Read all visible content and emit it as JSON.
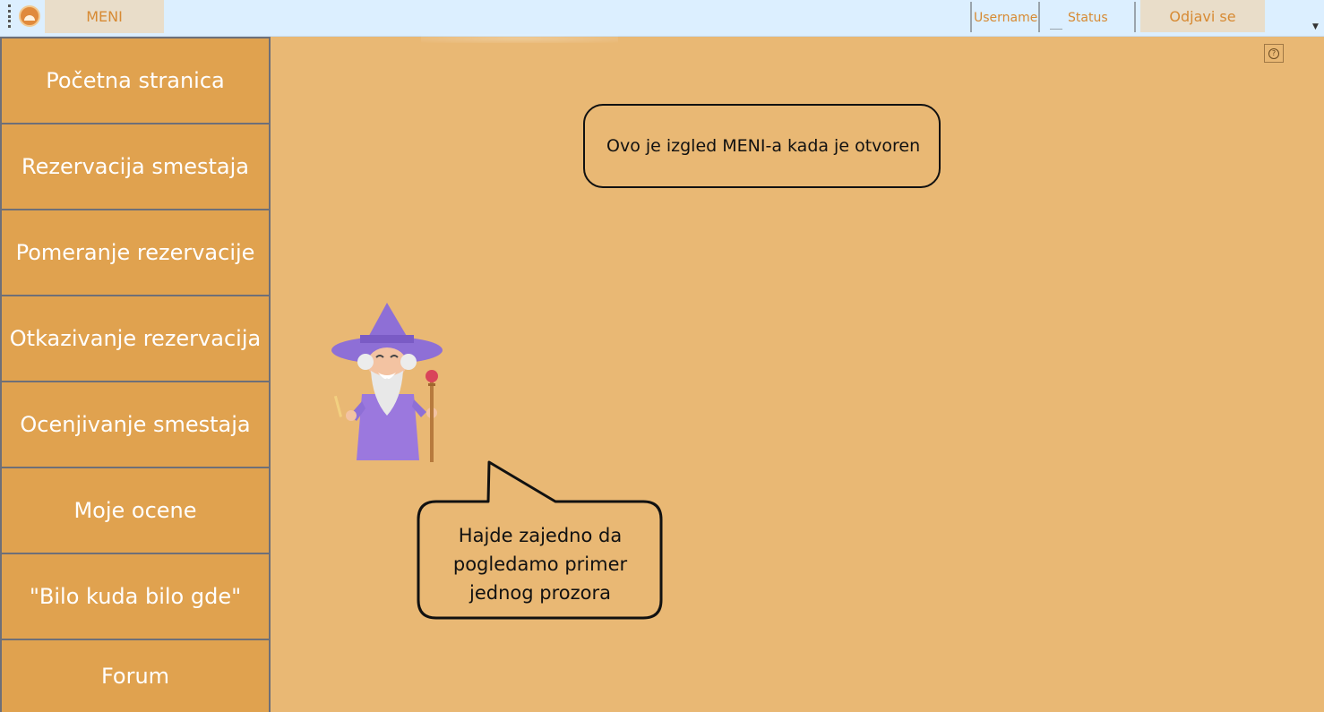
{
  "toolbar": {
    "menu_button": "MENI",
    "username": "Username",
    "status": "Status",
    "logout_button": "Odjavi se"
  },
  "sidebar": {
    "items": [
      {
        "label": "Početna stranica"
      },
      {
        "label": "Rezervacija smestaja"
      },
      {
        "label": "Pomeranje rezervacije"
      },
      {
        "label": "Otkazivanje rezervacija"
      },
      {
        "label": "Ocenjivanje smestaja"
      },
      {
        "label": "Moje ocene"
      },
      {
        "label": "\"Bilo kuda bilo gde\""
      },
      {
        "label": "Forum"
      }
    ]
  },
  "main": {
    "info_bubble": "Ovo je izgled MENI-a kada je otvoren",
    "wizard_bubble": {
      "line1": "Hajde zajedno da",
      "line2": "pogledamo primer",
      "line3": "jednog prozora"
    }
  },
  "colors": {
    "background": "#e9b874",
    "sidebar_item": "#e0a24f",
    "toolbar": "#dcefff",
    "accent_text": "#d78a33"
  },
  "icons": {
    "app_logo": "app-logo-icon",
    "help": "help-icon",
    "overflow": "chevron-down-icon"
  }
}
